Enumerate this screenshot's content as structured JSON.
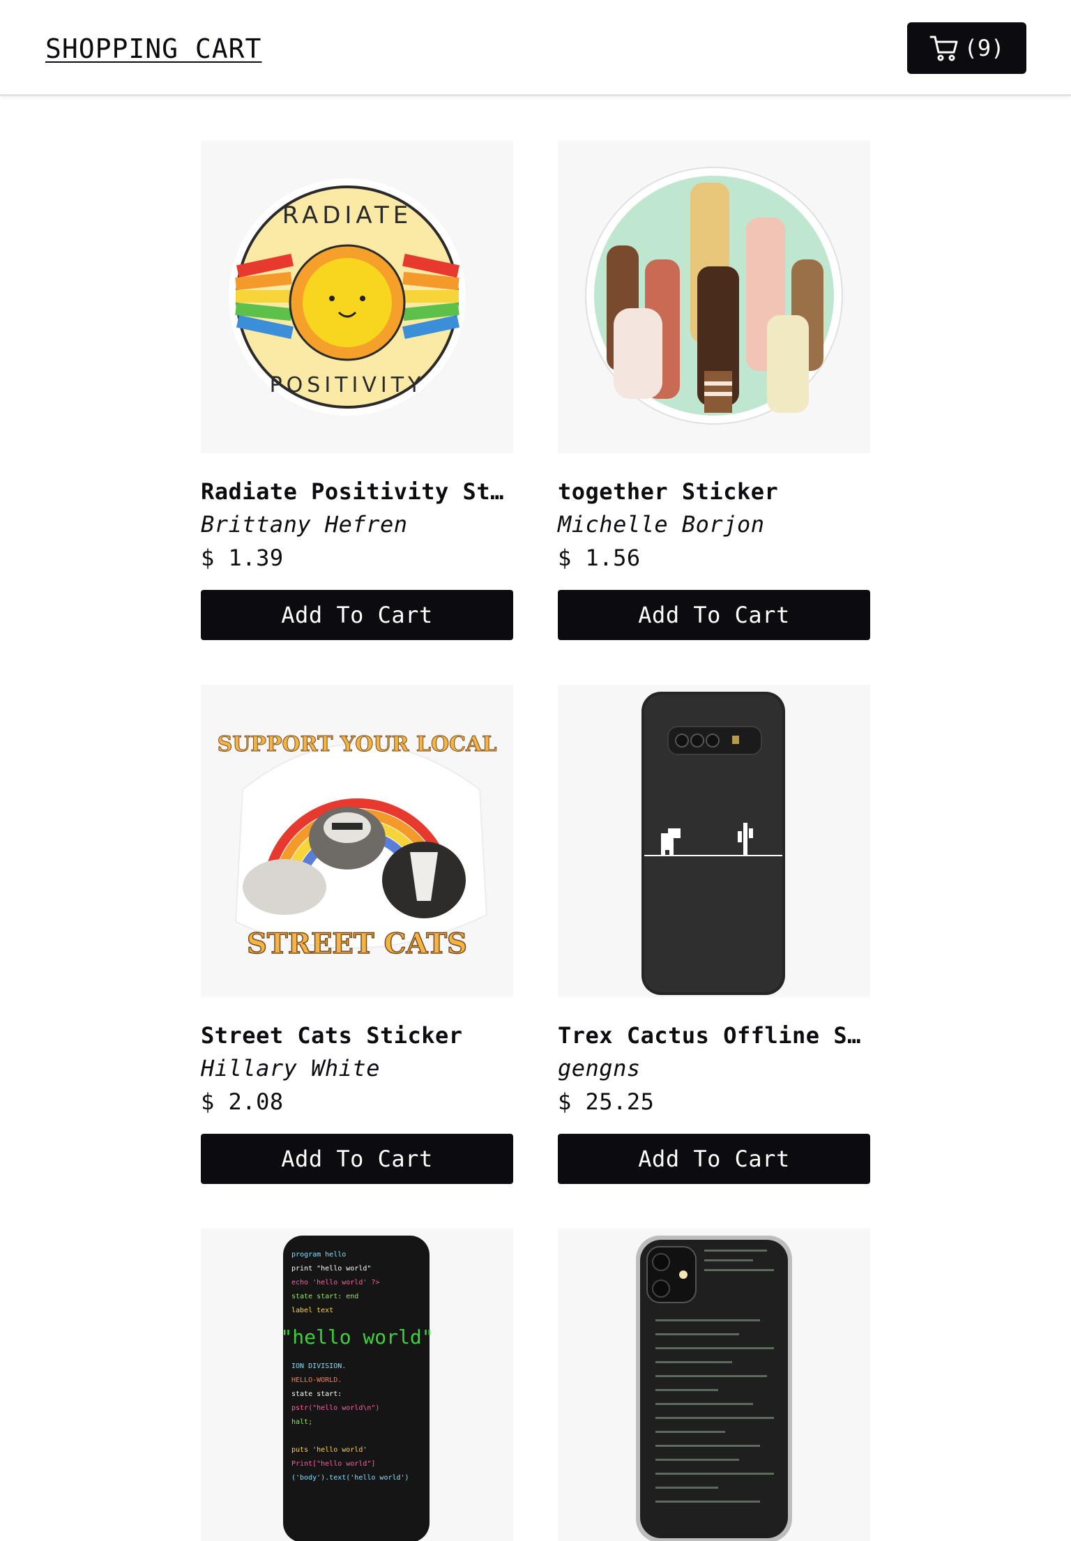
{
  "header": {
    "title": "SHOPPING CART",
    "cart_count_label": "(9)"
  },
  "products": [
    {
      "title": "Radiate Positivity St…",
      "artist": "Brittany Hefren",
      "price": "$ 1.39",
      "button": "Add To Cart",
      "image": "radiate-positivity-sticker",
      "art_text_top": "RADIATE",
      "art_text_bottom": "POSITIVITY"
    },
    {
      "title": "together Sticker",
      "artist": "Michelle Borjon",
      "price": "$ 1.56",
      "button": "Add To Cart",
      "image": "raised-fists-sticker"
    },
    {
      "title": "Street Cats Sticker",
      "artist": "Hillary White",
      "price": "$ 2.08",
      "button": "Add To Cart",
      "image": "street-cats-sticker",
      "art_text_top": "SUPPORT YOUR LOCAL",
      "art_text_bottom": "STREET CATS"
    },
    {
      "title": "Trex Cactus Offline S…",
      "artist": "gengns",
      "price": "$ 25.25",
      "button": "Add To Cart",
      "image": "trex-phone-case"
    },
    {
      "title": "",
      "artist": "",
      "price": "",
      "button": "",
      "image": "hello-world-phone-case",
      "art_text": "\"hello world\""
    },
    {
      "title": "",
      "artist": "",
      "price": "",
      "button": "",
      "image": "code-iphone-case"
    }
  ],
  "colors": {
    "primary": "#0b0b10",
    "thumb_bg": "#f7f7f8"
  }
}
